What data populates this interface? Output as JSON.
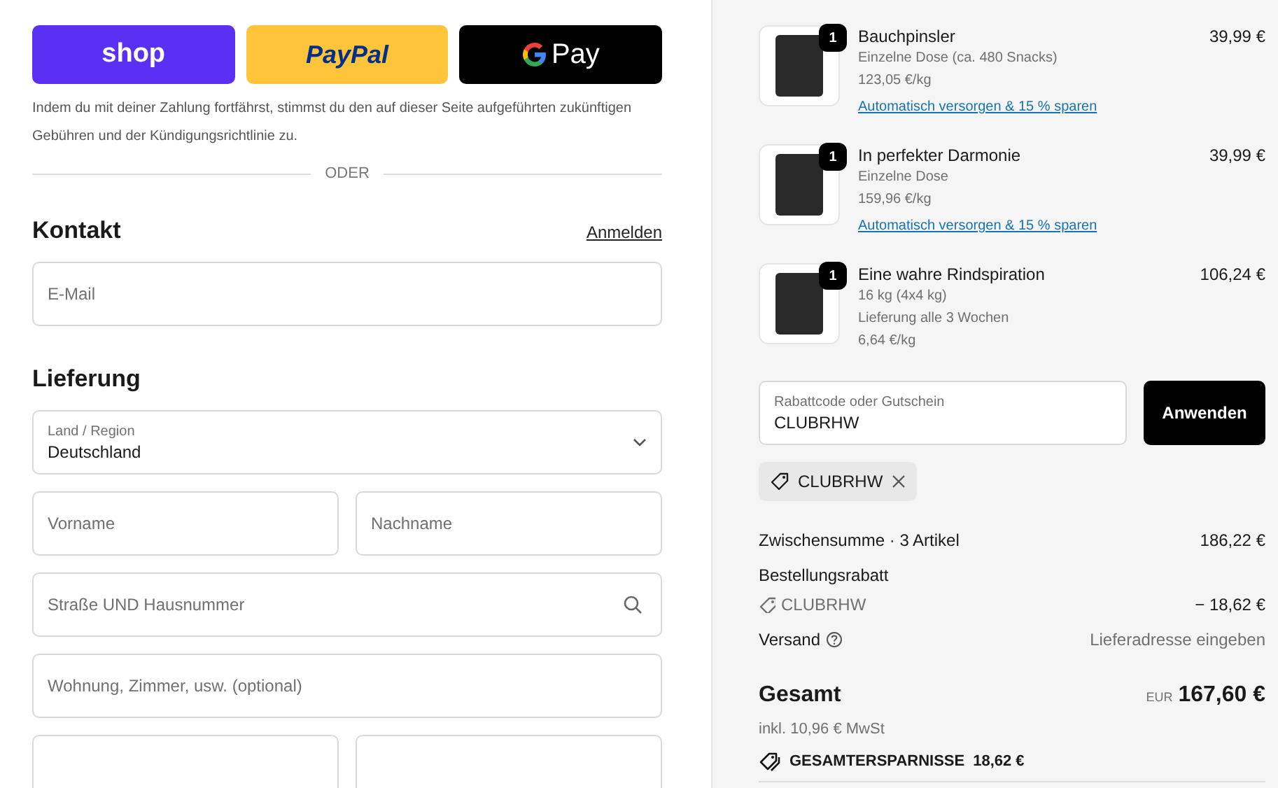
{
  "express_buttons": [
    {
      "kind": "shop",
      "label": "shop"
    },
    {
      "kind": "paypal",
      "label": "PayPal"
    },
    {
      "kind": "gpay",
      "label": "Pay"
    }
  ],
  "disclaimer": "Indem du mit deiner Zahlung fortfährst, stimmst du den auf dieser Seite aufgeführten zukünftigen Gebühren und der Kündigungsrichtlinie zu.",
  "divider_label": "ODER",
  "contact": {
    "heading": "Kontakt",
    "login_link": "Anmelden",
    "email": {
      "placeholder": "E-Mail"
    }
  },
  "delivery": {
    "heading": "Lieferung",
    "fields": [
      {
        "kind": "select",
        "label": "Land / Region",
        "value": "Deutschland"
      },
      {
        "kind": "pair",
        "fields": [
          {
            "placeholder": "Vorname"
          },
          {
            "placeholder": "Nachname"
          }
        ]
      },
      {
        "kind": "search",
        "placeholder": "Straße UND Hausnummer"
      },
      {
        "kind": "text",
        "placeholder": "Wohnung, Zimmer, usw. (optional)"
      },
      {
        "kind": "blank_pair"
      }
    ]
  },
  "cart_items": [
    {
      "quantity": "1",
      "name": "Bauchpinsler",
      "details": [
        "Einzelne Dose (ca. 480 Snacks)",
        "123,05 €/kg"
      ],
      "link": "Automatisch versorgen & 15 % sparen",
      "price": "39,99 €"
    },
    {
      "quantity": "1",
      "name": "In perfekter Darmonie",
      "details": [
        "Einzelne Dose",
        "159,96 €/kg"
      ],
      "link": "Automatisch versorgen & 15 % sparen",
      "price": "39,99 €"
    },
    {
      "quantity": "1",
      "name": "Eine wahre Rindspiration",
      "details": [
        "16 kg (4x4 kg)",
        "Lieferung alle 3 Wochen",
        "6,64 €/kg"
      ],
      "price": "106,24 €"
    }
  ],
  "discount": {
    "label": "Rabattcode oder Gutschein",
    "value": "CLUBRHW",
    "button": "Anwenden",
    "applied_tag": "CLUBRHW"
  },
  "summary": {
    "subtotal_label": "Zwischensumme · 3 Artikel",
    "subtotal": "186,22 €",
    "order_discount_label": "Bestellungsrabatt",
    "discount_code": "CLUBRHW",
    "discount_amount": "− 18,62 €",
    "shipping_label": "Versand",
    "shipping_value": "Lieferadresse eingeben",
    "total_label": "Gesamt",
    "currency": "EUR",
    "total": "167,60 €",
    "tax_note": "inkl. 10,96 € MwSt",
    "savings_label": "GESAMTERSPARNISSE",
    "savings": "18,62 €"
  }
}
